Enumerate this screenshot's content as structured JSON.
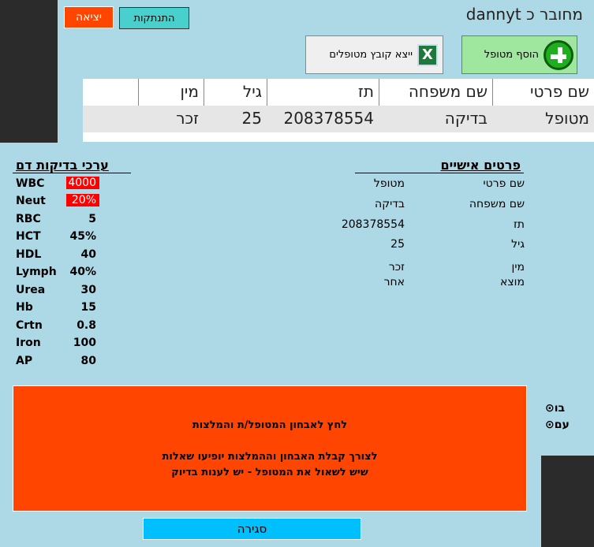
{
  "topbar": {
    "exit_label": "יציאה",
    "logout_label": "התנתקות",
    "connected_text": "מחובר כ dannyt"
  },
  "toolbar": {
    "add_patient_label": "הוסף מטופל",
    "export_label": "ייצא קובץ מטופלים",
    "excel_glyph": "X"
  },
  "table": {
    "headers": {
      "first_name": "שם פרטי",
      "last_name": "שם משפחה",
      "id": "תז",
      "age": "גיל",
      "gender": "מין"
    },
    "row": {
      "first_name": "מטופל",
      "last_name": "בדיקה",
      "id": "208378554",
      "age": "25",
      "gender": "זכר"
    }
  },
  "personal": {
    "title": "פרטים אישיים",
    "labels": [
      "שם פרטי",
      "שם משפחה",
      "תז",
      "גיל",
      "מין",
      "מוצא"
    ],
    "values": [
      "מטופל",
      "בדיקה",
      "208378554",
      "25",
      "זכר",
      "אחר"
    ]
  },
  "blood": {
    "title": "ערכי בדיקות דם",
    "items": [
      {
        "name": "WBC",
        "value": "4000",
        "abnormal": true
      },
      {
        "name": "Neut",
        "value": "20%",
        "abnormal": true
      },
      {
        "name": "RBC",
        "value": "5"
      },
      {
        "name": "HCT",
        "value": "45%"
      },
      {
        "name": "HDL",
        "value": "40"
      },
      {
        "name": "Lymph",
        "value": "40%"
      },
      {
        "name": "Urea",
        "value": "30"
      },
      {
        "name": "Hb",
        "value": "15"
      },
      {
        "name": "Crtn",
        "value": "0.8"
      },
      {
        "name": "Iron",
        "value": "100"
      },
      {
        "name": "AP",
        "value": "80"
      }
    ]
  },
  "diagnosis": {
    "line1": "לחץ לאבחון המטופל/ת והמלצות",
    "line2": "לצורך קבלת האבחון וההמלצות יופיעו שאלות",
    "line3": "שיש לשאול את המטופל  - יש לענות בדיוק"
  },
  "close_label": "סגירה",
  "side_options": [
    "⊙בו",
    "⊙עם"
  ],
  "colors": {
    "exit": "#ff4500",
    "logout": "#48d1cc",
    "add": "#9fe79f",
    "panel": "#add8e6",
    "abnormal": "#ff0000",
    "close": "#00bfff"
  }
}
